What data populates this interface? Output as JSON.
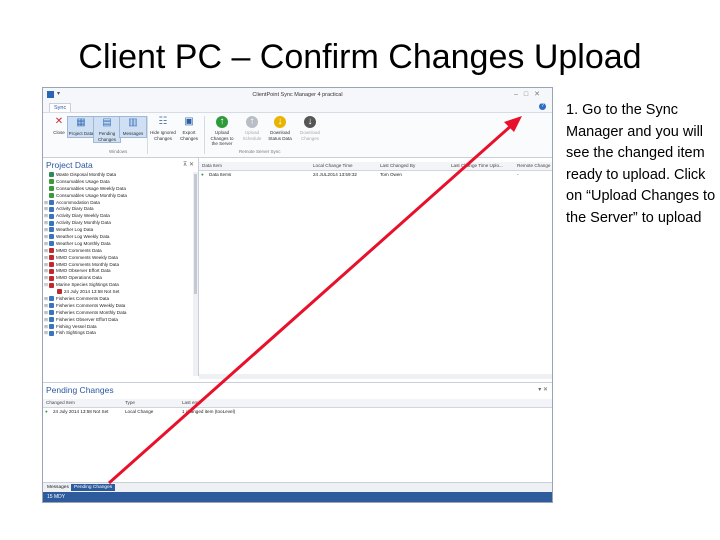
{
  "slide": {
    "title": "Client PC – Confirm Changes Upload",
    "instruction": "1. Go to the Sync Manager and you will see the changed item ready to upload. Click on “Upload Changes to the Server” to upload"
  },
  "app": {
    "window_title": "ClientPoint Sync Manager 4 practical",
    "tab": "Sync",
    "ribbon": {
      "close": "Close",
      "project_data": "Project Data",
      "pending_changes": "Pending Changes",
      "messages": "Messages",
      "hide_ignored_changes": "Hide Ignored Changes",
      "export_changes": "Export Changes",
      "upload_changes": "Upload Changes to the Server",
      "upload_schedule": "Upload Schedule",
      "download_status_data": "Download Status Data",
      "download_changes": "Download Changes",
      "group_windows": "Windows",
      "group_remote": "Remote Server Sync"
    },
    "project_data": {
      "title": "Project Data",
      "items": [
        "Waste Disposal Monthly Data",
        "Consumables Usage Data",
        "Consumables Usage Weekly Data",
        "Consumables Usage Monthly Data",
        "Accommodation Data",
        "Activity Diary Data",
        "Activity Diary Weekly Data",
        "Activity Diary Monthly Data",
        "Weather Log Data",
        "Weather Log Weekly Data",
        "Weather Log Monthly Data",
        "MMO Comments Data",
        "MMO Comments Weekly Data",
        "MMO Comments Monthly Data",
        "MMO Observer Effort Data",
        "MMO Operations Data",
        "Marine Species Sightings Data",
        "24 July 2014 13:58 Not Set",
        "Fisheries Comments Data",
        "Fisheries Comments Weekly Data",
        "Fisheries Comments Monthly Data",
        "Fisheries Observer Effort Data",
        "Fishing Vessel Data",
        "Fish Sightings Data"
      ]
    },
    "grid": {
      "columns": [
        "Data Item",
        "Local Change Time",
        "Last Changed By",
        "Last Change Time Uplo...",
        "Remote Change"
      ],
      "rows": [
        {
          "item": "Data Items",
          "time": "24 JUL2014 13:59:32",
          "by": "Tom Owen",
          "uplo": "",
          "remote": "-"
        }
      ]
    },
    "pending": {
      "title": "Pending Changes",
      "columns": [
        "Changed Item",
        "Type",
        "Last emit"
      ],
      "rows": [
        {
          "item": "24 July 2014 13:58 Not Set",
          "type": "Local Change",
          "summary": "1 changed item (tooLevel)"
        }
      ]
    },
    "bottom_tabs": [
      "Messages",
      "Pending Changes"
    ],
    "status": "15 MDY"
  },
  "colors": {
    "accent": "#2a56a0",
    "status_bar": "#2d5b9c",
    "arrow": "#e8102a"
  }
}
